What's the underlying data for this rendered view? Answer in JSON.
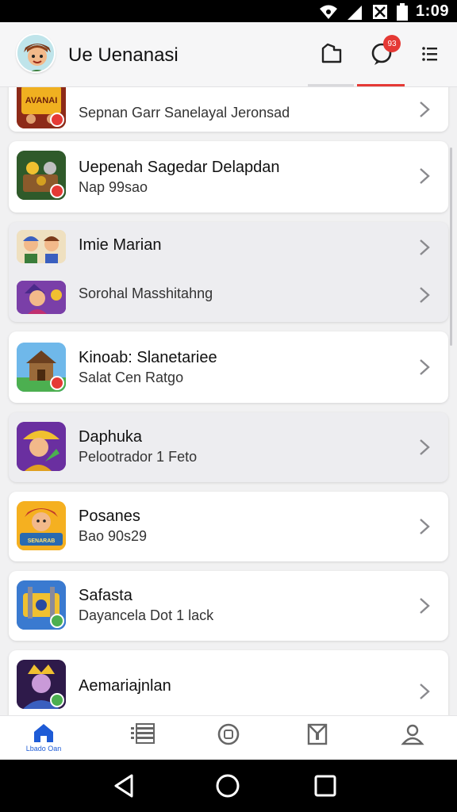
{
  "status_bar": {
    "time": "1:09",
    "icons": [
      "wifi-icon",
      "signal-icon",
      "no-sim-icon",
      "battery-icon"
    ]
  },
  "app_bar": {
    "title": "Ue Uenanasi",
    "actions": [
      {
        "name": "folder-icon"
      },
      {
        "name": "chat-icon",
        "badge": "93"
      },
      {
        "name": "menu-icon"
      }
    ]
  },
  "list": {
    "items": [
      {
        "title": "",
        "subtitle": "Sepnan Garr Sanelayal Jeronsad",
        "thumb_text": "AVANAI"
      },
      {
        "title": "Uepenah Sagedar Delapdan",
        "subtitle": "Nap 99sao"
      },
      {
        "title": "Imie Marian",
        "subtitle": ""
      },
      {
        "title": "",
        "subtitle": "Sorohal Masshitahng"
      },
      {
        "title": "Kinoab: Slanetariee",
        "subtitle": "Salat Cen Ratgo"
      },
      {
        "title": "Daphuka",
        "subtitle": "Pelootrador 1 Feto"
      },
      {
        "title": "Posanes",
        "subtitle": "Bao 90s29",
        "thumb_text": "SENARAB"
      },
      {
        "title": "Safasta",
        "subtitle": "Dayancela Dot 1 lack"
      },
      {
        "title": "Aemariajnlan",
        "subtitle": ""
      }
    ]
  },
  "bottom_nav": {
    "active_label": "Lbado Oan",
    "items": [
      "home-icon",
      "list-icon",
      "clock-icon",
      "inbox-icon",
      "profile-icon"
    ]
  },
  "colors": {
    "accent": "#1e5bd6",
    "badge": "#e53935",
    "indicator": "#e53935"
  }
}
